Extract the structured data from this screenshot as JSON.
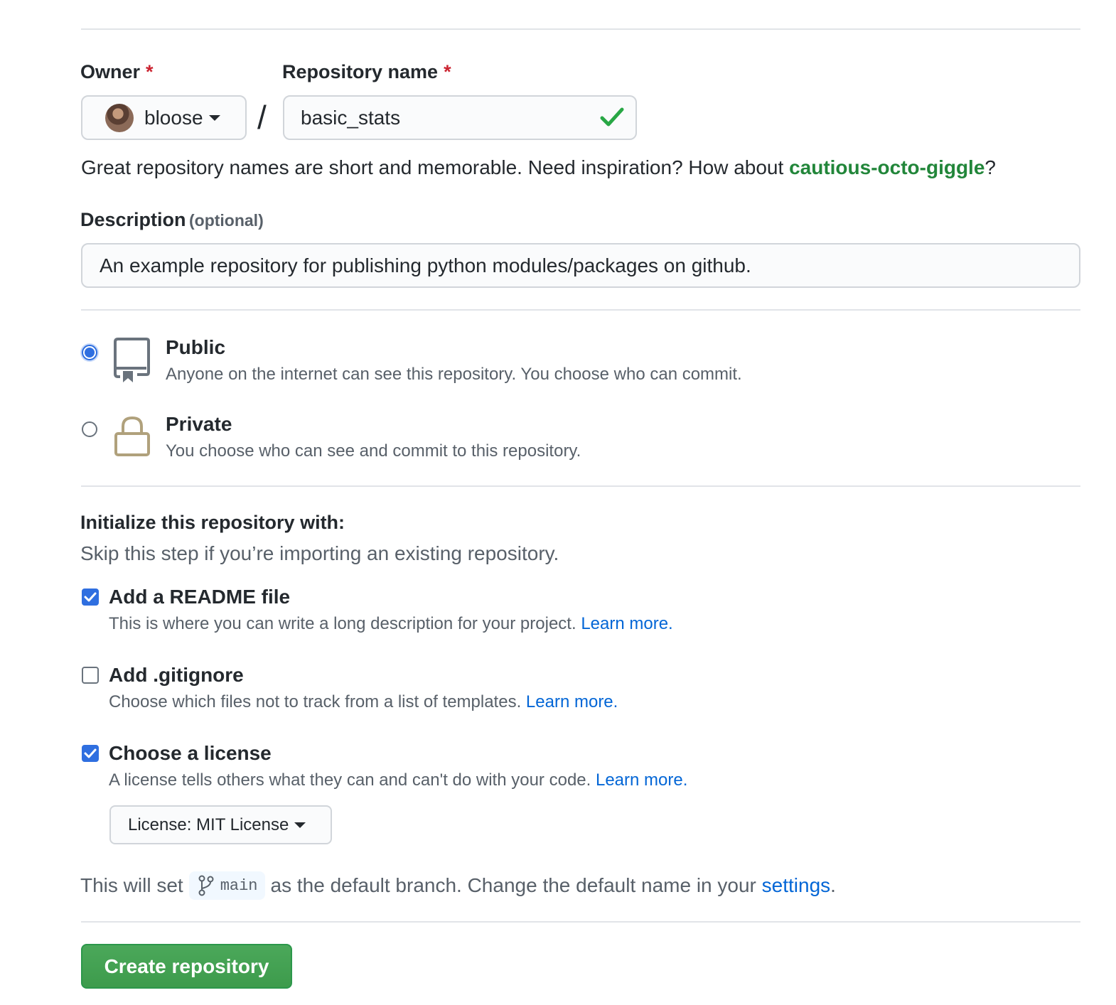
{
  "owner": {
    "label": "Owner",
    "required_mark": "*",
    "value": "bloose"
  },
  "separator": "/",
  "repo_name": {
    "label": "Repository name",
    "required_mark": "*",
    "value": "basic_stats",
    "status_icon": "check-icon"
  },
  "name_hint": {
    "text": "Great repository names are short and memorable. Need inspiration? How about ",
    "suggestion": "cautious-octo-giggle",
    "suffix": "?"
  },
  "description": {
    "label": "Description",
    "optional": "(optional)",
    "value": "An example repository for publishing python modules/packages on github."
  },
  "visibility": {
    "public": {
      "title": "Public",
      "desc": "Anyone on the internet can see this repository. You choose who can commit.",
      "selected": true,
      "icon": "repo-icon"
    },
    "private": {
      "title": "Private",
      "desc": "You choose who can see and commit to this repository.",
      "selected": false,
      "icon": "lock-icon"
    }
  },
  "init": {
    "heading": "Initialize this repository with:",
    "subheading": "Skip this step if you’re importing an existing repository.",
    "readme": {
      "title": "Add a README file",
      "desc": "This is where you can write a long description for your project.",
      "link": "Learn more.",
      "checked": true
    },
    "gitignore": {
      "title": "Add .gitignore",
      "desc": "Choose which files not to track from a list of templates.",
      "link": "Learn more.",
      "checked": false
    },
    "license": {
      "title": "Choose a license",
      "desc": "A license tells others what they can and can't do with your code.",
      "link": "Learn more.",
      "checked": true,
      "select_label": "License: MIT License"
    }
  },
  "branch": {
    "prefix": "This will set",
    "name": "main",
    "middle": "as the default branch. Change the default name in your",
    "link": "settings",
    "suffix": "."
  },
  "submit": {
    "label": "Create repository"
  },
  "colors": {
    "accent_green": "#2ea44f",
    "link_blue": "#0366d6",
    "required_red": "#cb2431",
    "checkbox_blue": "#2f6fe0"
  }
}
